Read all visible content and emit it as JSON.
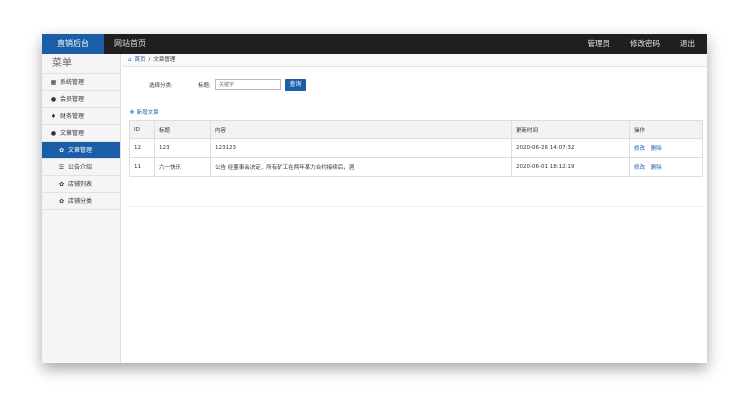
{
  "topbar": {
    "brand": "直销后台",
    "nav_home": "网站首页",
    "right": [
      "管理员",
      "修改密码",
      "退出"
    ]
  },
  "sidebar": {
    "title": "菜单",
    "items": [
      {
        "label": "系统管理",
        "icon": "grid-icon"
      },
      {
        "label": "会员管理",
        "icon": "user-icon"
      },
      {
        "label": "财务管理",
        "icon": "money-icon"
      },
      {
        "label": "文章管理",
        "icon": "user-icon"
      }
    ],
    "subitems": [
      {
        "label": "文章管理",
        "active": true
      },
      {
        "label": "公告介绍",
        "active": false
      },
      {
        "label": "店铺列表",
        "active": false
      },
      {
        "label": "店铺分类",
        "active": false
      }
    ]
  },
  "breadcrumb": {
    "home": "首页",
    "current": "文章管理"
  },
  "filter": {
    "category_label": "选择分类:",
    "title_label": "标题:",
    "search_placeholder": "关键字",
    "query_button": "查询"
  },
  "add_article": "新增文章",
  "table": {
    "headers": [
      "ID",
      "标题",
      "内容",
      "更新时间",
      "操作"
    ],
    "rows": [
      {
        "id": "12",
        "title": "123",
        "content": "123123",
        "time": "2020-06-26 14:07:32",
        "edit": "修改",
        "delete": "删除"
      },
      {
        "id": "11",
        "title": "六一快乐",
        "content": "公告 经董事会决定，所有矿工在两年某力合约接续后，酒",
        "time": "2020-06-01 18:12:19",
        "edit": "修改",
        "delete": "删除"
      }
    ]
  }
}
